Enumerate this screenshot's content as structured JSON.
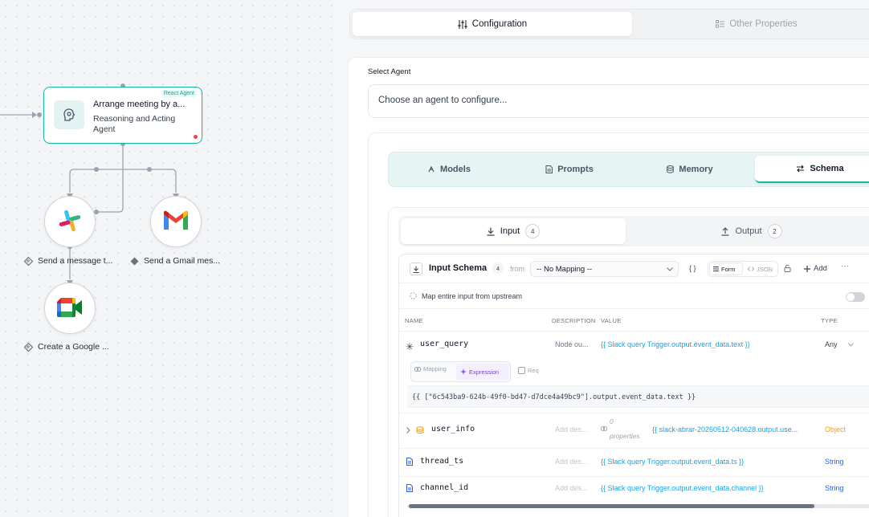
{
  "canvas": {
    "agent_node": {
      "badge": "React Agent",
      "title": "Arrange meeting by a...",
      "subtitle": "Reasoning and Acting Agent"
    },
    "tools": [
      {
        "label": "Send a message t...",
        "icon": "slack-icon"
      },
      {
        "label": "Send a Gmail mes...",
        "icon": "gmail-icon"
      },
      {
        "label": "Create a Google ...",
        "icon": "google-meet-icon"
      }
    ]
  },
  "panel": {
    "tabs": {
      "configuration": "Configuration",
      "other": "Other Properties"
    },
    "select_agent_label": "Select Agent",
    "select_agent_placeholder": "Choose an agent to configure...",
    "sub_tabs": {
      "models": "Models",
      "prompts": "Prompts",
      "memory": "Memory",
      "schema": "Schema"
    },
    "io_tabs": {
      "input": "Input",
      "input_count": "4",
      "output": "Output",
      "output_count": "2"
    },
    "schema": {
      "title": "Input Schema",
      "count": "4",
      "from_label": "from",
      "mapping_value": "-- No Mapping --",
      "braces": "{ }",
      "form_label": "Form",
      "json_label": "JSON",
      "add_label": "Add",
      "more": "···",
      "map_entire_label": "Map entire input from upstream",
      "columns": {
        "name": "NAME",
        "description": "DESCRIPTION",
        "value": "VALUE",
        "type": "TYPE"
      },
      "mode": {
        "mapping": "Mapping",
        "expression": "Expression",
        "req": "Req"
      },
      "expression_text": "{{ [\"6c543ba9-624b-49f0-bd47-d7dce4a49bc9\"].output.event_data.text }}",
      "rows": [
        {
          "name": "user_query",
          "description": "Node ou...",
          "value": "{{ Slack query Trigger.output.event_data.text }}",
          "type": "Any"
        },
        {
          "name": "user_info",
          "description": "Add des...",
          "props_count": "0",
          "props_label": "properties",
          "value": "{{ slack-abrar-20260512-040628.output.use...",
          "type": "Object"
        },
        {
          "name": "thread_ts",
          "description": "Add des...",
          "value": "{{ Slack query Trigger.output.event_data.ts }}",
          "type": "String"
        },
        {
          "name": "channel_id",
          "description": "Add des...",
          "value": "{{ Slack query Trigger.output.event_data.channel }}",
          "type": "String"
        }
      ]
    }
  },
  "colors": {
    "accent": "#14b8a6",
    "link": "#0ea5e9",
    "object_type": "#f59e0b",
    "string_type": "#2563eb",
    "expression": "#7c3aed"
  }
}
